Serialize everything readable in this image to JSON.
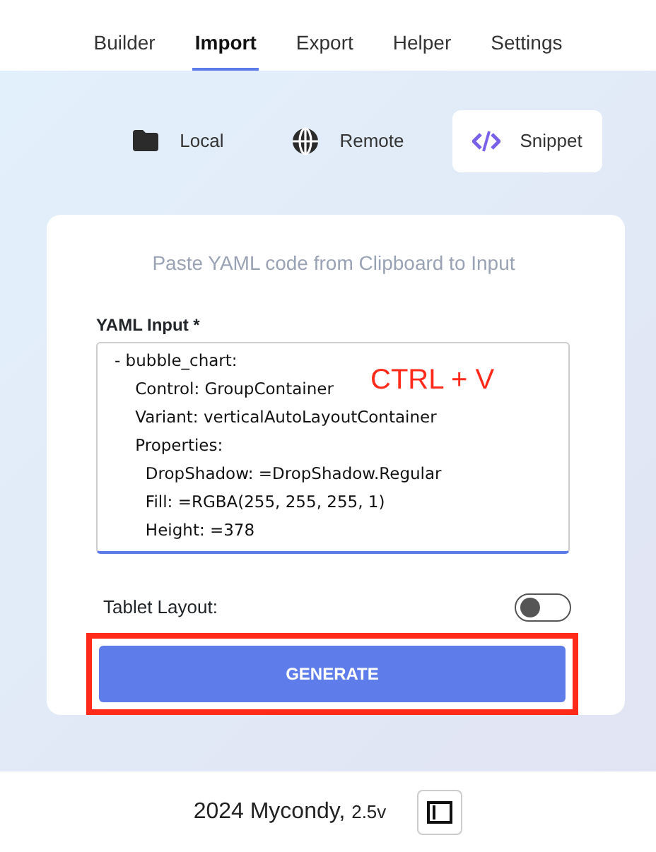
{
  "tabs": [
    {
      "label": "Builder",
      "selected": false
    },
    {
      "label": "Import",
      "selected": true
    },
    {
      "label": "Export",
      "selected": false
    },
    {
      "label": "Helper",
      "selected": false
    },
    {
      "label": "Settings",
      "selected": false
    }
  ],
  "sources": [
    {
      "label": "Local",
      "kind": "folder",
      "selected": false
    },
    {
      "label": "Remote",
      "kind": "globe",
      "selected": false
    },
    {
      "label": "Snippet",
      "kind": "code",
      "selected": true
    }
  ],
  "card": {
    "hint": "Paste YAML code from Clipboard to Input",
    "input_label": "YAML Input *",
    "input_lines": [
      "- bubble_chart:",
      "    Control: GroupContainer",
      "    Variant: verticalAutoLayoutContainer",
      "    Properties:",
      "      DropShadow: =DropShadow.Regular",
      "      Fill: =RGBA(255, 255, 255, 1)",
      "      Height: =378"
    ],
    "annotation": "CTRL + V",
    "toggle": {
      "label": "Tablet Layout:",
      "on": false
    },
    "button": "GENERATE",
    "button_highlighted": true
  },
  "footer": {
    "text": "2024 Mycondy,",
    "version": "2.5v"
  }
}
